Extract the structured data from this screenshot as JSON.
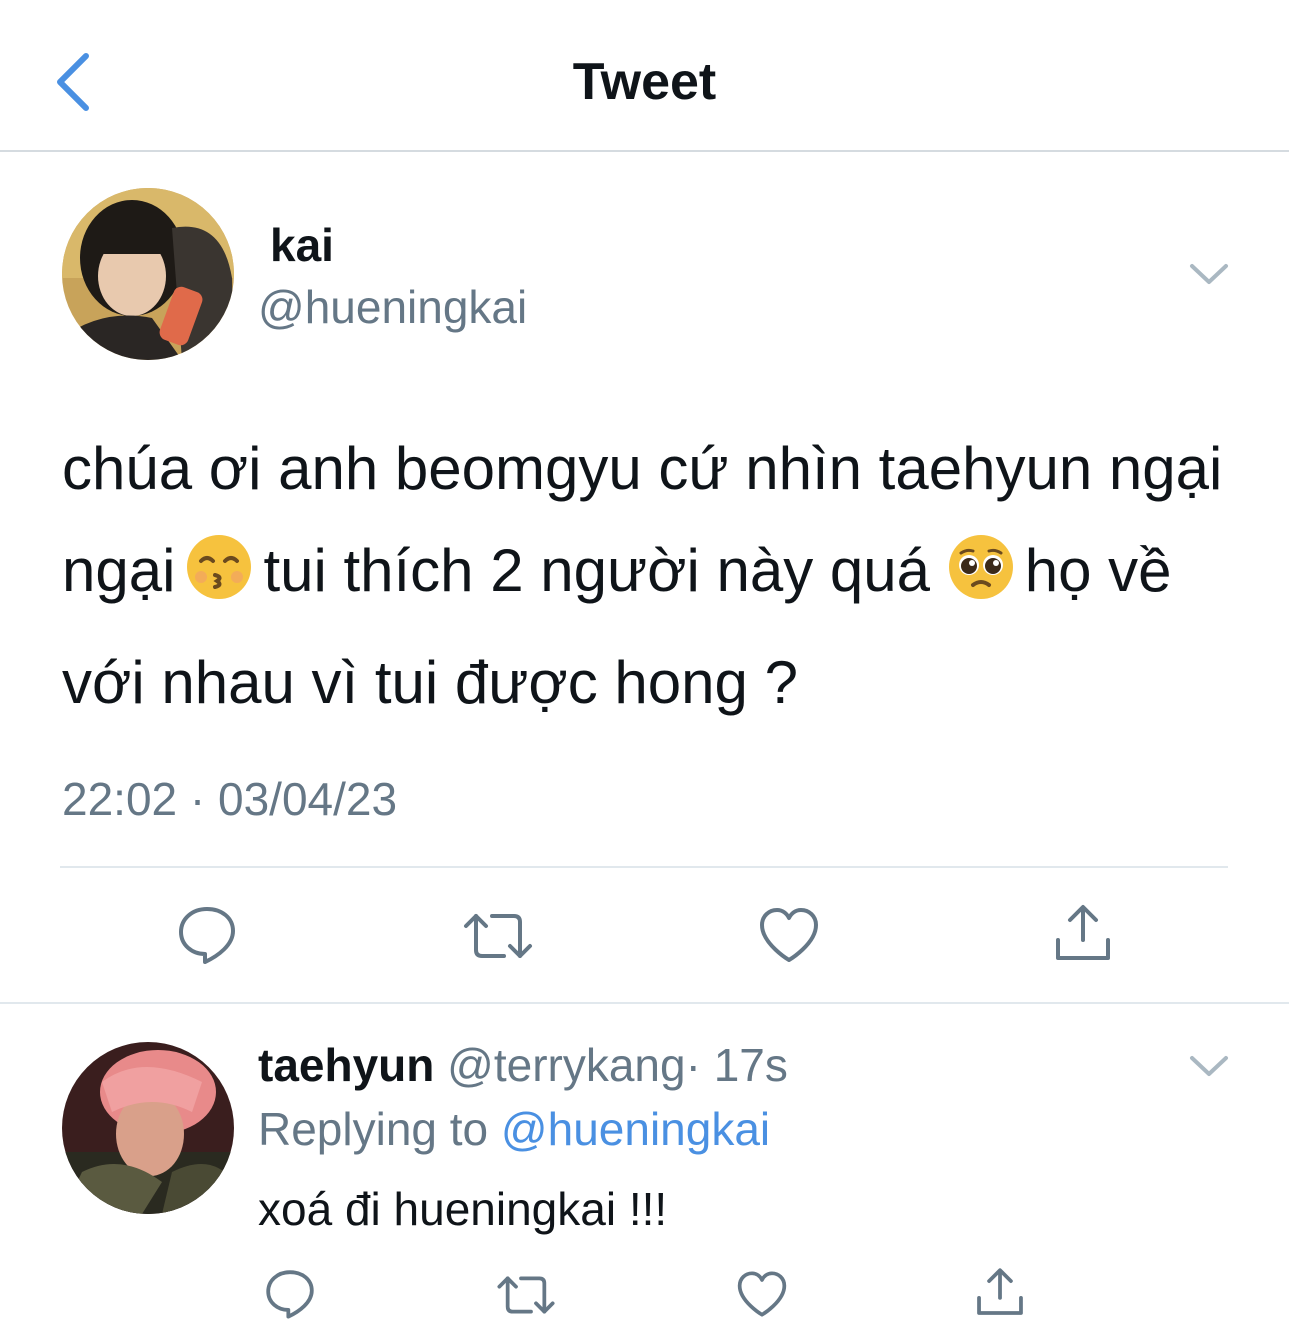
{
  "header": {
    "title": "Tweet"
  },
  "tweet": {
    "display_name": "kai",
    "handle": "@hueningkai",
    "text_part1": "chúa ơi anh beomgyu cứ nhìn taehyun ngại ngại",
    "text_part2": "tui thích 2 người này quá",
    "text_part3": "họ về với nhau vì tui được hong ?",
    "emoji_1": "kissing-face-with-closed-eyes",
    "emoji_2": "pleading-face",
    "timestamp": "22:02 · 03/04/23"
  },
  "reply": {
    "display_name": "taehyun",
    "handle": "@terrykang",
    "time": "· 17s",
    "replying_prefix": "Replying to",
    "replying_to": "@hueningkai",
    "text": "xoá đi hueningkai !!!"
  },
  "colors": {
    "accent": "#4a90e2",
    "secondary_text": "#657786",
    "icon": "#657786",
    "divider": "#e1e8ed"
  }
}
